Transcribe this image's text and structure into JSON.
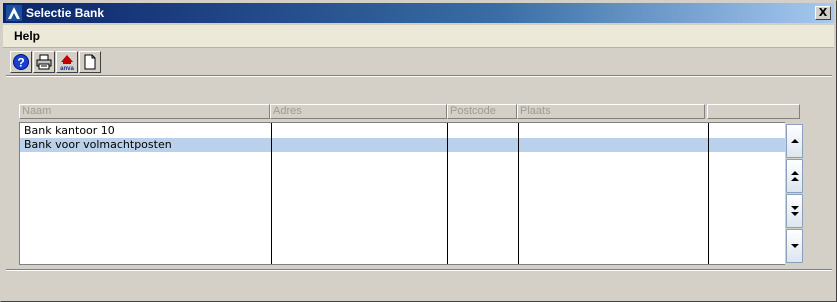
{
  "window": {
    "title": "Selectie Bank",
    "close_label": "X"
  },
  "menu": {
    "items": [
      {
        "label": "Help"
      }
    ]
  },
  "toolbar": {
    "buttons": [
      {
        "icon": "help-icon",
        "tooltip": ""
      },
      {
        "icon": "print-icon",
        "tooltip": ""
      },
      {
        "icon": "anva-logo-icon",
        "label": "anva"
      },
      {
        "icon": "new-document-icon",
        "tooltip": ""
      }
    ]
  },
  "columns": [
    {
      "label": "Naam"
    },
    {
      "label": "Adres"
    },
    {
      "label": "Postcode"
    },
    {
      "label": "Plaats"
    },
    {
      "label": ""
    }
  ],
  "rows": [
    {
      "naam": "Bank kantoor 10",
      "adres": "",
      "postcode": "",
      "plaats": "",
      "selected": false
    },
    {
      "naam": "Bank voor volmachtposten",
      "adres": "",
      "postcode": "",
      "plaats": "",
      "selected": true
    }
  ],
  "colors": {
    "titlebar_start": "#0a246a",
    "selected_row": "#b9d1ea",
    "window_bg": "#d4d0c8"
  }
}
